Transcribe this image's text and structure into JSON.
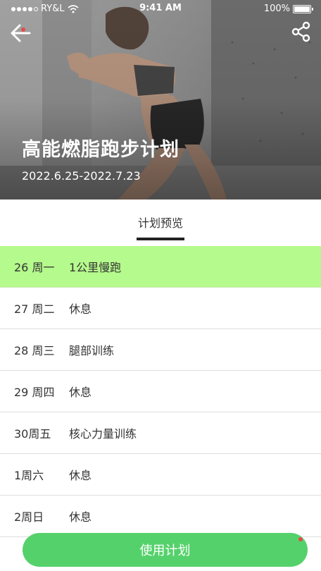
{
  "status_bar": {
    "carrier": "RY&L",
    "time": "9:41 AM",
    "battery": "100%"
  },
  "header": {
    "back_icon": "arrow-left-icon",
    "share_icon": "share-icon",
    "title": "高能燃脂跑步计划",
    "date_range": "2022.6.25-2022.7.23"
  },
  "tabs": [
    {
      "label": "计划预览",
      "active": true
    }
  ],
  "schedule": [
    {
      "day": "26 周一",
      "task": "1公里慢跑",
      "highlighted": true
    },
    {
      "day": "27 周二",
      "task": "休息",
      "highlighted": false
    },
    {
      "day": "28 周三",
      "task": "腿部训练",
      "highlighted": false
    },
    {
      "day": "29 周四",
      "task": "休息",
      "highlighted": false
    },
    {
      "day": "30周五",
      "task": "核心力量训练",
      "highlighted": false
    },
    {
      "day": "1周六",
      "task": "休息",
      "highlighted": false
    },
    {
      "day": "2周日",
      "task": "休息",
      "highlighted": false
    }
  ],
  "footer": {
    "use_plan_label": "使用计划"
  },
  "colors": {
    "highlight_row": "#b5fa8c",
    "primary_button": "#55d16b",
    "tab_indicator": "#222222"
  }
}
